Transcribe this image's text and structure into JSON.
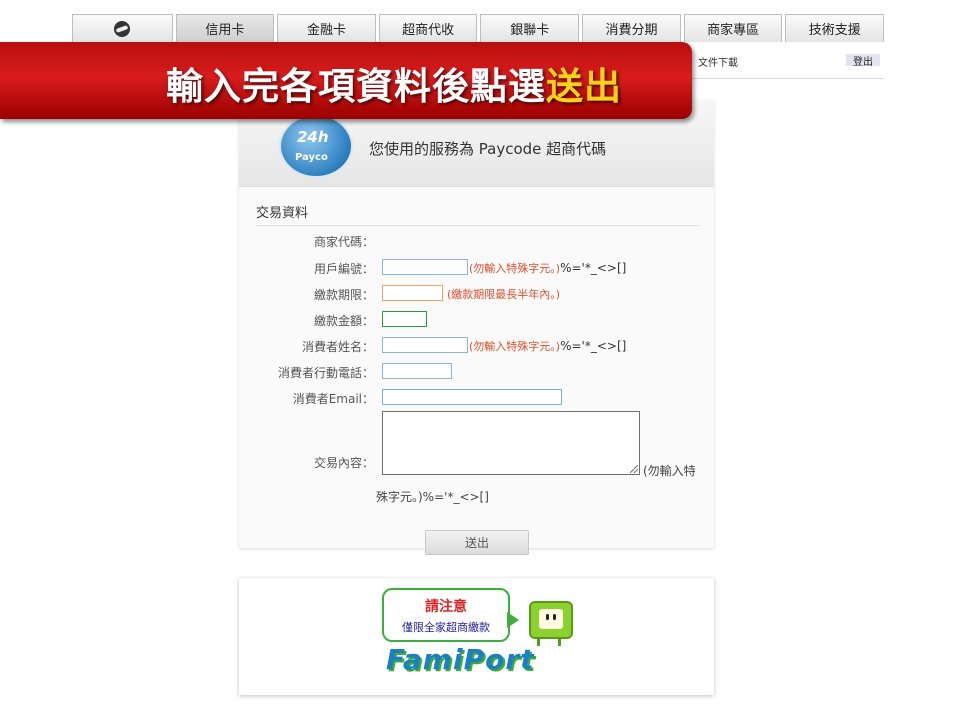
{
  "tabs": [
    {
      "label": ""
    },
    {
      "label": "信用卡"
    },
    {
      "label": "金融卡"
    },
    {
      "label": "超商代收"
    },
    {
      "label": "銀聯卡"
    },
    {
      "label": "消費分期"
    },
    {
      "label": "商家專區"
    },
    {
      "label": "技術支援"
    }
  ],
  "subnav": {
    "docs_link": "文件下載",
    "logout": "登出"
  },
  "banner": {
    "text": "輸入完各項資料後點選",
    "highlight": "送出"
  },
  "service": {
    "logo_top": "24h",
    "logo_name": "Payco",
    "title": "您使用的服務為 Paycode 超商代碼"
  },
  "form": {
    "section_title": "交易資料",
    "merchant_code_label": "商家代碼：",
    "user_no_label": "用戶編號：",
    "user_no_hint": "(勿輸入特殊字元。)",
    "user_no_hint_chars": "%='*_<>[]",
    "deadline_label": "繳款期限：",
    "deadline_hint": "(繳款期限最長半年內。)",
    "amount_label": "繳款金額：",
    "name_label": "消費者姓名：",
    "name_hint": "(勿輸入特殊字元。)",
    "name_hint_chars": "%='*_<>[]",
    "phone_label": "消費者行動電話：",
    "email_label": "消費者Email：",
    "content_label": "交易內容：",
    "content_hint_a": "(勿輸入特",
    "content_hint_b": "殊字元。)%='*_<>[]",
    "submit_label": "送出"
  },
  "notice": {
    "title": "請注意",
    "subtitle": "僅限全家超商繳款",
    "brand": "FamiPort"
  }
}
